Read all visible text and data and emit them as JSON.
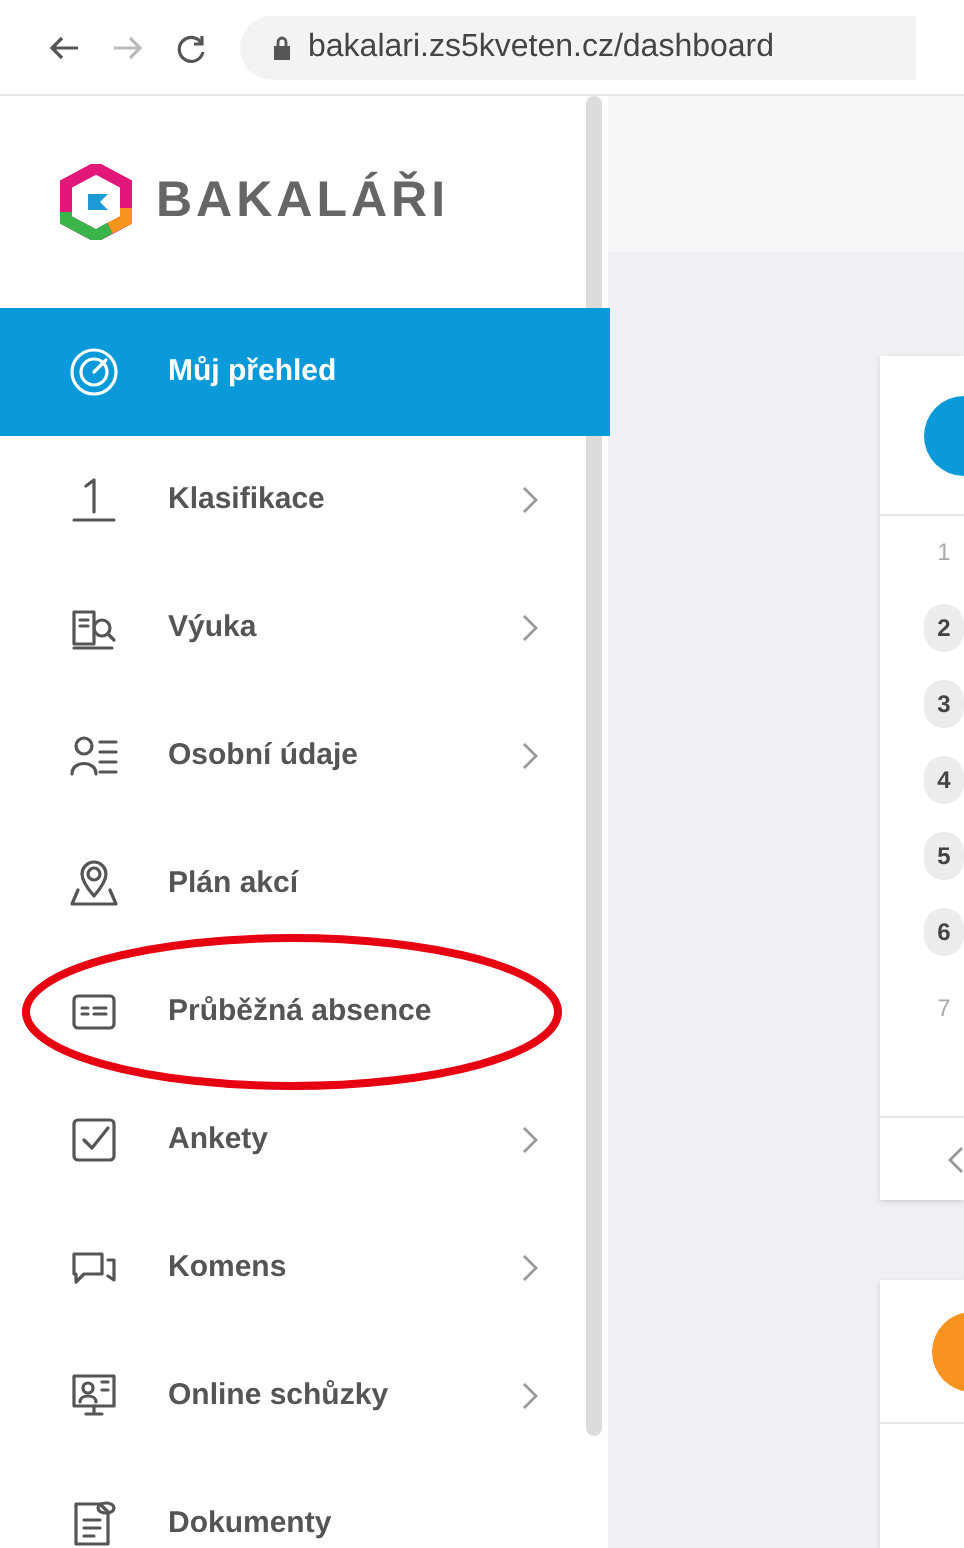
{
  "browser": {
    "url": "bakalari.zs5kveten.cz/dashboard"
  },
  "logo": {
    "text": "BAKALÁŘI"
  },
  "sidebar": {
    "items": [
      {
        "label": "Můj přehled",
        "selected": true,
        "has_submenu": false,
        "circled": false
      },
      {
        "label": "Klasifikace",
        "selected": false,
        "has_submenu": true,
        "circled": false
      },
      {
        "label": "Výuka",
        "selected": false,
        "has_submenu": true,
        "circled": false
      },
      {
        "label": "Osobní údaje",
        "selected": false,
        "has_submenu": true,
        "circled": false
      },
      {
        "label": "Plán akcí",
        "selected": false,
        "has_submenu": false,
        "circled": false
      },
      {
        "label": "Průběžná absence",
        "selected": false,
        "has_submenu": false,
        "circled": true
      },
      {
        "label": "Ankety",
        "selected": false,
        "has_submenu": true,
        "circled": false
      },
      {
        "label": "Komens",
        "selected": false,
        "has_submenu": true,
        "circled": false
      },
      {
        "label": "Online schůzky",
        "selected": false,
        "has_submenu": true,
        "circled": false
      },
      {
        "label": "Dokumenty",
        "selected": false,
        "has_submenu": false,
        "circled": false
      }
    ]
  },
  "timetable_card": {
    "rows": [
      {
        "number": "1",
        "marked": false
      },
      {
        "number": "2",
        "marked": true
      },
      {
        "number": "3",
        "marked": true
      },
      {
        "number": "4",
        "marked": true
      },
      {
        "number": "5",
        "marked": true
      },
      {
        "number": "6",
        "marked": true
      },
      {
        "number": "7",
        "marked": false
      }
    ]
  }
}
